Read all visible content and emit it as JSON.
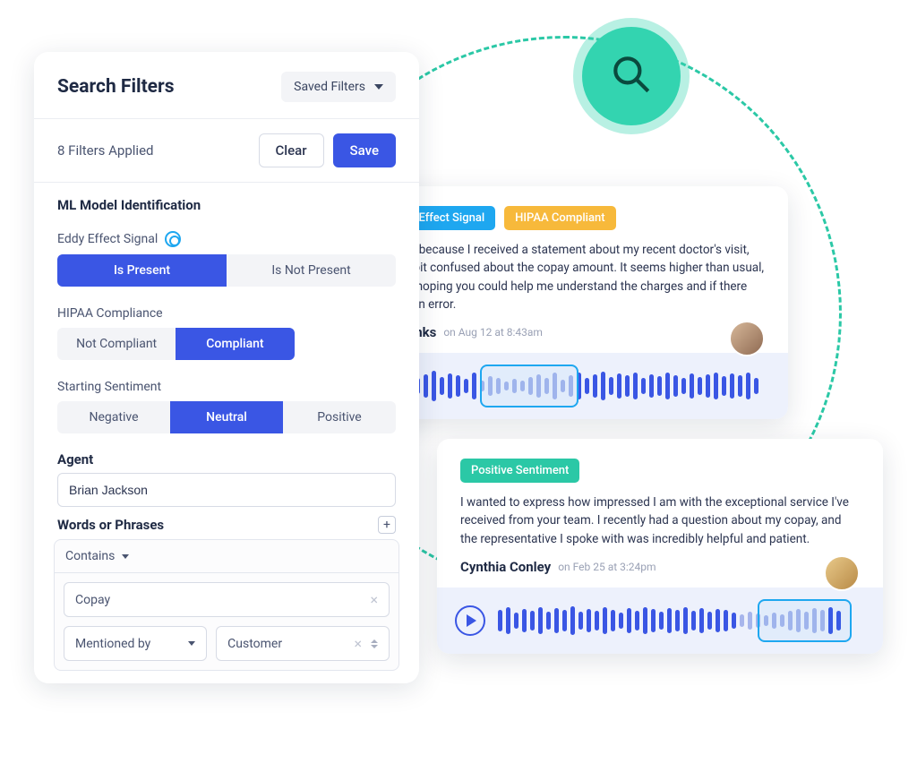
{
  "decor": {
    "floating_icon": "search-icon"
  },
  "filters": {
    "title": "Search Filters",
    "saved_filters_label": "Saved Filters",
    "applied_text": "8 Filters Applied",
    "clear_label": "Clear",
    "save_label": "Save",
    "ml_section_title": "ML Model Identification",
    "eddy_label": "Eddy Effect Signal",
    "eddy_options": {
      "present": "Is Present",
      "not_present": "Is Not Present",
      "selected": "present"
    },
    "hipaa_label": "HIPAA Compliance",
    "hipaa_options": {
      "not_compliant": "Not Compliant",
      "compliant": "Compliant",
      "selected": "compliant"
    },
    "sentiment_label": "Starting Sentiment",
    "sentiment_options": {
      "negative": "Negative",
      "neutral": "Neutral",
      "positive": "Positive",
      "selected": "neutral"
    },
    "agent_label": "Agent",
    "agent_value": "Brian Jackson",
    "phrases_label": "Words or Phrases",
    "phrase_group": {
      "condition": "Contains",
      "term": "Copay",
      "mentioned_by_label": "Mentioned by",
      "mentioned_by_value": "Customer"
    }
  },
  "cards": [
    {
      "tags": [
        {
          "style": "blue",
          "icon": "signal",
          "text": "Eddy Effect Signal"
        },
        {
          "style": "yellow",
          "text": "HIPAA Compliant"
        }
      ],
      "transcript": "I'm calling because I received a statement about my recent doctor's visit, and I'm a bit confused about the copay amount. It seems higher than usual, and I was hoping you could help me understand the charges and if there might be an error.",
      "caller": "Olivia Banks",
      "timestamp": "on Aug 12 at 8:43am",
      "play_state": "paused"
    },
    {
      "tags": [
        {
          "style": "teal",
          "text": "Positive Sentiment"
        }
      ],
      "transcript": "I wanted to express how impressed I am with the exceptional service I've received from your team. I recently had a question about my copay, and the representative I spoke with was incredibly helpful and patient.",
      "caller": "Cynthia Conley",
      "timestamp": "on Feb 25 at 3:24pm",
      "play_state": "play"
    }
  ]
}
